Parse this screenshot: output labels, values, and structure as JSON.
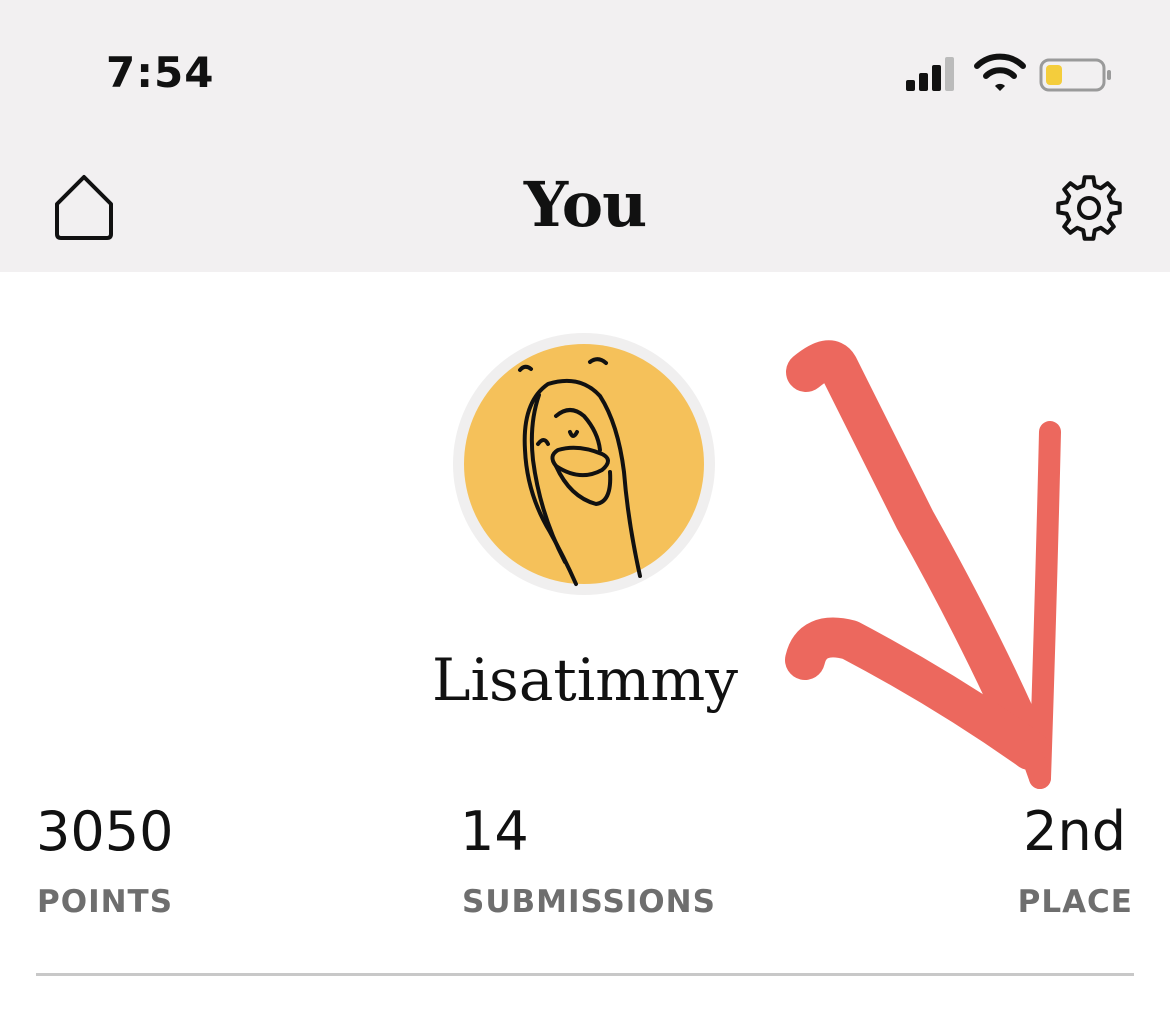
{
  "status_bar": {
    "time": "7:54",
    "signal_icon": "cellular-signal-icon",
    "wifi_icon": "wifi-icon",
    "battery_icon": "battery-icon",
    "battery_level": 0.3,
    "battery_color": "#f4cd3c"
  },
  "header": {
    "title": "You",
    "home_icon": "home-icon",
    "settings_icon": "gear-icon",
    "background": "#f2f0f1"
  },
  "profile": {
    "username": "Lisatimmy",
    "avatar_icon": "duck-avatar",
    "avatar_color": "#f5c15a"
  },
  "stats": [
    {
      "value": "3050",
      "label": "POINTS"
    },
    {
      "value": "14",
      "label": "SUBMISSIONS"
    },
    {
      "value": "2nd",
      "label": "PLACE"
    }
  ],
  "annotation": {
    "type": "hand-drawn arrow",
    "color": "#e8473b"
  }
}
